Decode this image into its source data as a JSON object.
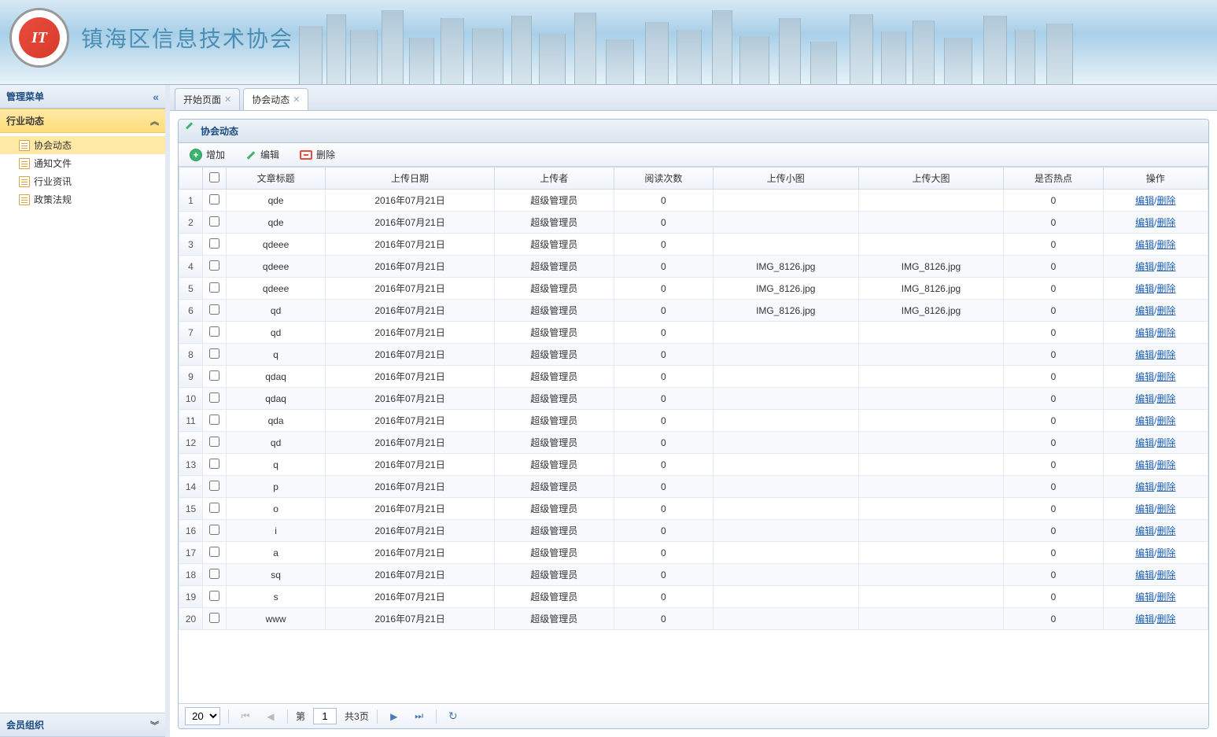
{
  "header": {
    "title": "镇海区信息技术协会",
    "logo_text": "IT",
    "logo_sub": "镇海区信息技术协会"
  },
  "sidebar": {
    "title": "管理菜单",
    "sections": [
      {
        "title": "行业动态",
        "expanded": true,
        "items": [
          {
            "label": "协会动态",
            "active": true
          },
          {
            "label": "通知文件",
            "active": false
          },
          {
            "label": "行业资讯",
            "active": false
          },
          {
            "label": "政策法规",
            "active": false
          }
        ]
      },
      {
        "title": "会员组织",
        "expanded": false,
        "items": []
      }
    ]
  },
  "tabs": [
    {
      "label": "开始页面",
      "active": false,
      "closable": true
    },
    {
      "label": "协会动态",
      "active": true,
      "closable": true
    }
  ],
  "panel": {
    "title": "协会动态"
  },
  "toolbar": {
    "add": "增加",
    "edit": "编辑",
    "delete": "删除"
  },
  "grid": {
    "columns": [
      "",
      "",
      "文章标题",
      "上传日期",
      "上传者",
      "阅读次数",
      "上传小图",
      "上传大图",
      "是否热点",
      "操作"
    ],
    "action_edit": "编辑",
    "action_delete": "删除",
    "rows": [
      {
        "n": 1,
        "title": "qde",
        "date": "2016年07月21日",
        "uploader": "超级管理员",
        "reads": "0",
        "thumb": "",
        "big": "",
        "hot": "0"
      },
      {
        "n": 2,
        "title": "qde",
        "date": "2016年07月21日",
        "uploader": "超级管理员",
        "reads": "0",
        "thumb": "",
        "big": "",
        "hot": "0"
      },
      {
        "n": 3,
        "title": "qdeee",
        "date": "2016年07月21日",
        "uploader": "超级管理员",
        "reads": "0",
        "thumb": "",
        "big": "",
        "hot": "0"
      },
      {
        "n": 4,
        "title": "qdeee",
        "date": "2016年07月21日",
        "uploader": "超级管理员",
        "reads": "0",
        "thumb": "IMG_8126.jpg",
        "big": "IMG_8126.jpg",
        "hot": "0"
      },
      {
        "n": 5,
        "title": "qdeee",
        "date": "2016年07月21日",
        "uploader": "超级管理员",
        "reads": "0",
        "thumb": "IMG_8126.jpg",
        "big": "IMG_8126.jpg",
        "hot": "0"
      },
      {
        "n": 6,
        "title": "qd",
        "date": "2016年07月21日",
        "uploader": "超级管理员",
        "reads": "0",
        "thumb": "IMG_8126.jpg",
        "big": "IMG_8126.jpg",
        "hot": "0"
      },
      {
        "n": 7,
        "title": "qd",
        "date": "2016年07月21日",
        "uploader": "超级管理员",
        "reads": "0",
        "thumb": "",
        "big": "",
        "hot": "0"
      },
      {
        "n": 8,
        "title": "q",
        "date": "2016年07月21日",
        "uploader": "超级管理员",
        "reads": "0",
        "thumb": "",
        "big": "",
        "hot": "0"
      },
      {
        "n": 9,
        "title": "qdaq",
        "date": "2016年07月21日",
        "uploader": "超级管理员",
        "reads": "0",
        "thumb": "",
        "big": "",
        "hot": "0"
      },
      {
        "n": 10,
        "title": "qdaq",
        "date": "2016年07月21日",
        "uploader": "超级管理员",
        "reads": "0",
        "thumb": "",
        "big": "",
        "hot": "0"
      },
      {
        "n": 11,
        "title": "qda",
        "date": "2016年07月21日",
        "uploader": "超级管理员",
        "reads": "0",
        "thumb": "",
        "big": "",
        "hot": "0"
      },
      {
        "n": 12,
        "title": "qd",
        "date": "2016年07月21日",
        "uploader": "超级管理员",
        "reads": "0",
        "thumb": "",
        "big": "",
        "hot": "0"
      },
      {
        "n": 13,
        "title": "q",
        "date": "2016年07月21日",
        "uploader": "超级管理员",
        "reads": "0",
        "thumb": "",
        "big": "",
        "hot": "0"
      },
      {
        "n": 14,
        "title": "p",
        "date": "2016年07月21日",
        "uploader": "超级管理员",
        "reads": "0",
        "thumb": "",
        "big": "",
        "hot": "0"
      },
      {
        "n": 15,
        "title": "o",
        "date": "2016年07月21日",
        "uploader": "超级管理员",
        "reads": "0",
        "thumb": "",
        "big": "",
        "hot": "0"
      },
      {
        "n": 16,
        "title": "i",
        "date": "2016年07月21日",
        "uploader": "超级管理员",
        "reads": "0",
        "thumb": "",
        "big": "",
        "hot": "0"
      },
      {
        "n": 17,
        "title": "a",
        "date": "2016年07月21日",
        "uploader": "超级管理员",
        "reads": "0",
        "thumb": "",
        "big": "",
        "hot": "0"
      },
      {
        "n": 18,
        "title": "sq",
        "date": "2016年07月21日",
        "uploader": "超级管理员",
        "reads": "0",
        "thumb": "",
        "big": "",
        "hot": "0"
      },
      {
        "n": 19,
        "title": "s",
        "date": "2016年07月21日",
        "uploader": "超级管理员",
        "reads": "0",
        "thumb": "",
        "big": "",
        "hot": "0"
      },
      {
        "n": 20,
        "title": "www",
        "date": "2016年07月21日",
        "uploader": "超级管理员",
        "reads": "0",
        "thumb": "",
        "big": "",
        "hot": "0"
      }
    ]
  },
  "pagination": {
    "page_size": "20",
    "page_label_prefix": "第",
    "current_page": "1",
    "total_pages_label": "共3页"
  }
}
